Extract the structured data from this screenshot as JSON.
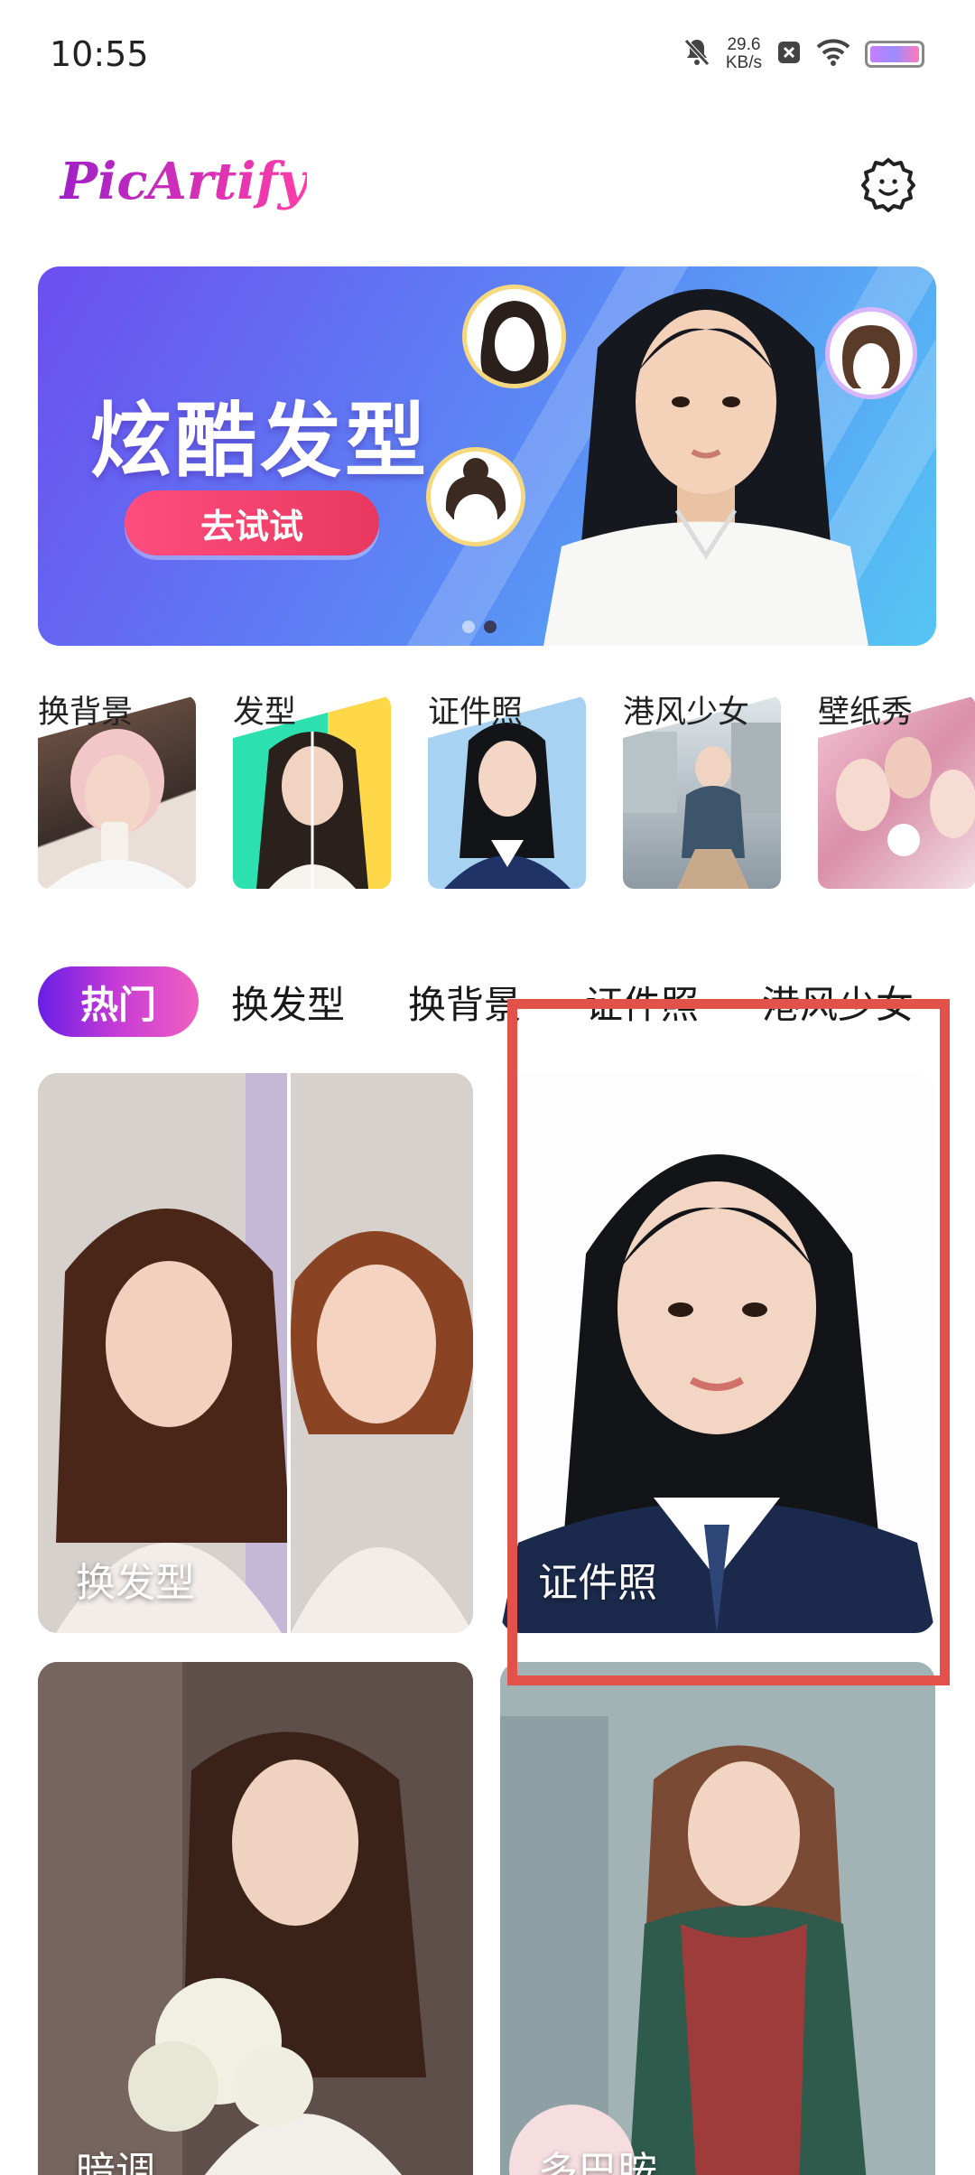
{
  "status_bar": {
    "time": "10:55",
    "net_speed_value": "29.6",
    "net_speed_unit": "KB/s",
    "icons": [
      "bell-muted-icon",
      "x-badge-icon",
      "wifi-icon",
      "battery-icon"
    ]
  },
  "header": {
    "logo_text": "PicArtify",
    "settings_icon": "gear-smile-icon"
  },
  "banner": {
    "title": "炫酷发型",
    "cta_label": "去试试",
    "page_count": 2,
    "active_page": 2
  },
  "shortcuts": {
    "items": [
      {
        "label": "换背景"
      },
      {
        "label": "发型"
      },
      {
        "label": "证件照"
      },
      {
        "label": "港风少女"
      },
      {
        "label": "壁纸秀"
      }
    ]
  },
  "tabs": {
    "items": [
      {
        "label": "热门",
        "active": true
      },
      {
        "label": "换发型",
        "active": false
      },
      {
        "label": "换背景",
        "active": false
      },
      {
        "label": "证件照",
        "active": false
      },
      {
        "label": "港风少女",
        "active": false
      }
    ]
  },
  "grid": {
    "cards": [
      {
        "label": "换发型"
      },
      {
        "label": "证件照"
      },
      {
        "label": "暗调"
      },
      {
        "label": "多巴胺"
      }
    ]
  },
  "colors": {
    "accent_gradient_start": "#6a1ee6",
    "accent_gradient_end": "#f060c0",
    "banner_blue": "#5a8cf5",
    "highlight_red": "#e2524a"
  }
}
